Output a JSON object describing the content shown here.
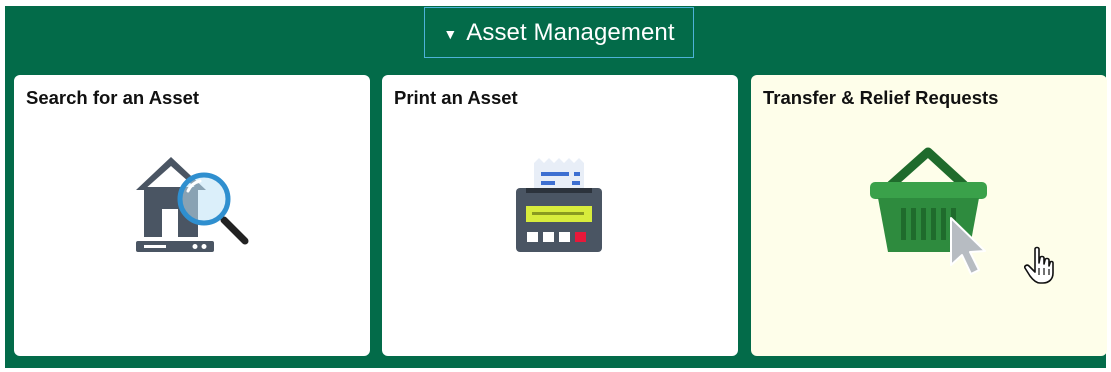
{
  "section": {
    "title": "Asset Management",
    "caret_icon": "caret-down-icon"
  },
  "tiles": [
    {
      "title": "Search for an Asset",
      "icon": "house-search-icon"
    },
    {
      "title": "Print an Asset",
      "icon": "printer-icon"
    },
    {
      "title": "Transfer & Relief Requests",
      "icon": "basket-icon"
    }
  ],
  "colors": {
    "frame": "#036b49",
    "header_border": "#4db3d8",
    "tile_bg": "#ffffff",
    "tile_hover_bg": "#fefeea",
    "basket_green": "#2e8b3e"
  }
}
